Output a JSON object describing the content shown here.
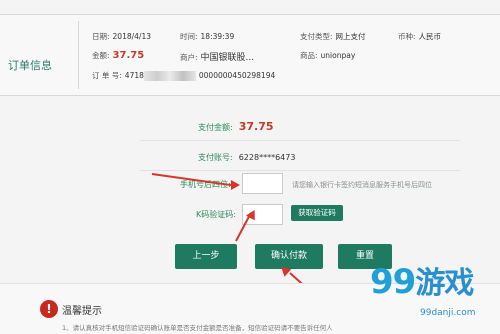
{
  "order": {
    "title": "订单信息",
    "date_label": "日期:",
    "date_value": "2018/4/13",
    "time_label": "时间:",
    "time_value": "18:39:39",
    "paytype_label": "支付类型:",
    "paytype_value": "网上支付",
    "currency_label": "币种:",
    "currency_value": "人民币",
    "amount_label": "金额:",
    "amount_value": "37.75",
    "merchant_label": "商户:",
    "merchant_value": "中国银联股...",
    "product_label": "商品:",
    "product_value": "unionpay",
    "orderno_label": "订 单 号:",
    "orderno_prefix": "4718",
    "orderno_suffix": "0000000450298194"
  },
  "form": {
    "pay_amount_label": "支付金额:",
    "pay_amount_value": "37.75",
    "pay_account_label": "支付账号:",
    "pay_account_value": "6228****6473",
    "phone_label": "手机号后四位:",
    "phone_hint": "请您输入银行卡签约短消息服务手机号后四位",
    "code_label": "K码验证码:",
    "get_code_button": "获取验证码"
  },
  "buttons": {
    "prev": "上一步",
    "confirm": "确认付款",
    "reset": "重置"
  },
  "tip": {
    "icon": "exclamation-icon",
    "title": "温馨提示",
    "line1": "1、请认真核对手机短信验证码确认账单是否支付金额是否准备，短信验证码请不要告诉任何人"
  },
  "watermark": {
    "brand_num": "99",
    "brand_cn": "游戏",
    "domain": "99danji.com"
  },
  "colors": {
    "accent": "#1e7b5f",
    "amount_red": "#c23b2a",
    "arrow": "#d9342b"
  }
}
